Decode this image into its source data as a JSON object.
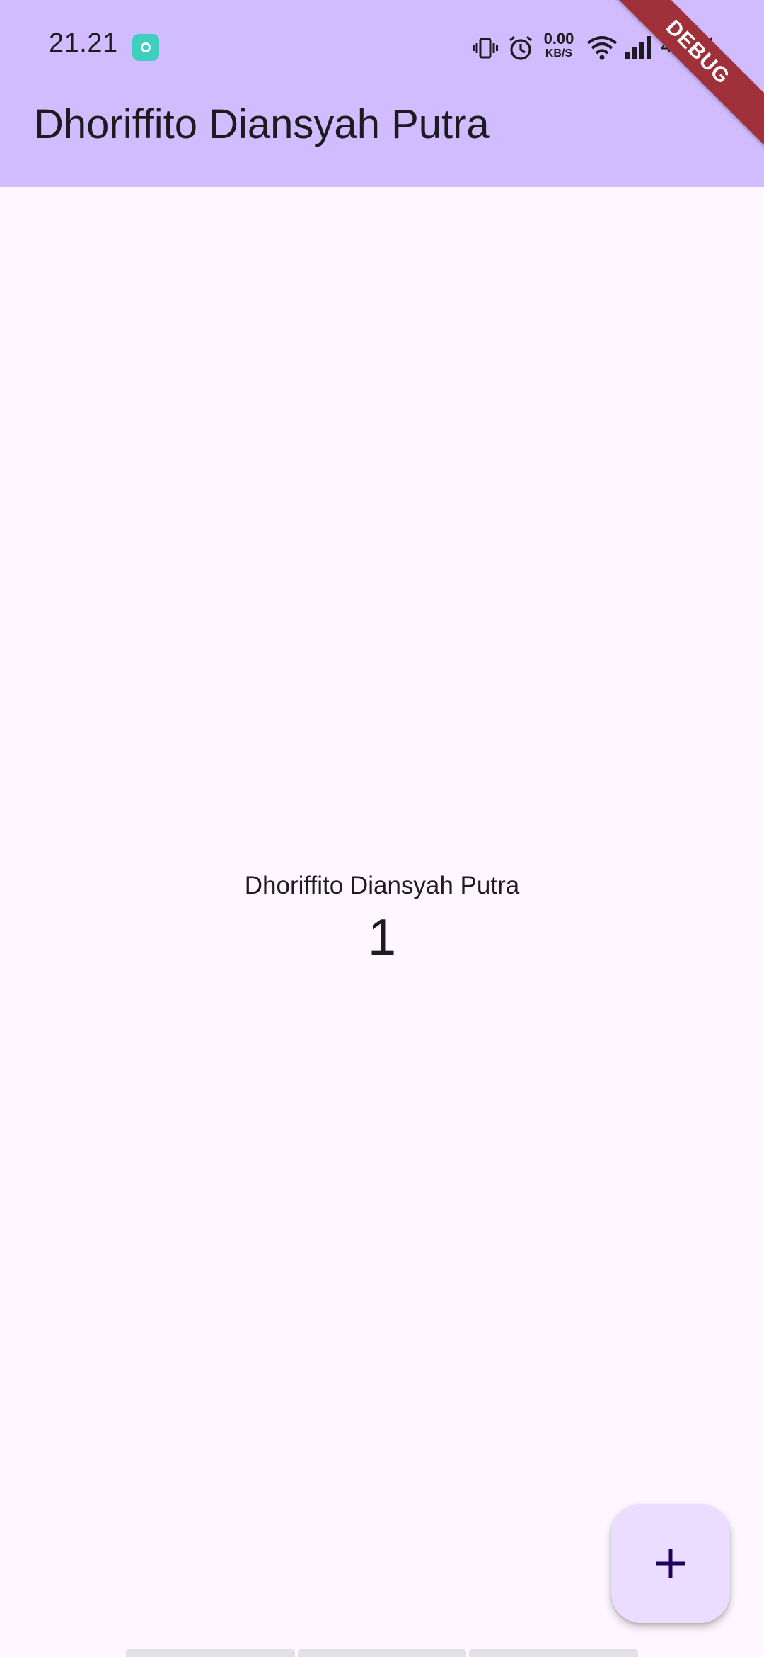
{
  "status_bar": {
    "time": "21.21",
    "net_speed_value": "0.00",
    "net_speed_unit": "KB/S",
    "battery": "49%",
    "icons": [
      "app-notification-icon",
      "vibrate-icon",
      "alarm-icon",
      "wifi-icon",
      "signal-icon",
      "charging-bolt-icon"
    ]
  },
  "app_bar": {
    "title": "Dhoriffito Diansyah Putra",
    "background": "#d0bcff"
  },
  "debug_banner": {
    "label": "DEBUG",
    "color": "#a0303a"
  },
  "body": {
    "label": "Dhoriffito Diansyah Putra",
    "counter": "1",
    "background": "#fef7ff"
  },
  "fab": {
    "icon": "add-icon",
    "background": "#eaddff"
  }
}
